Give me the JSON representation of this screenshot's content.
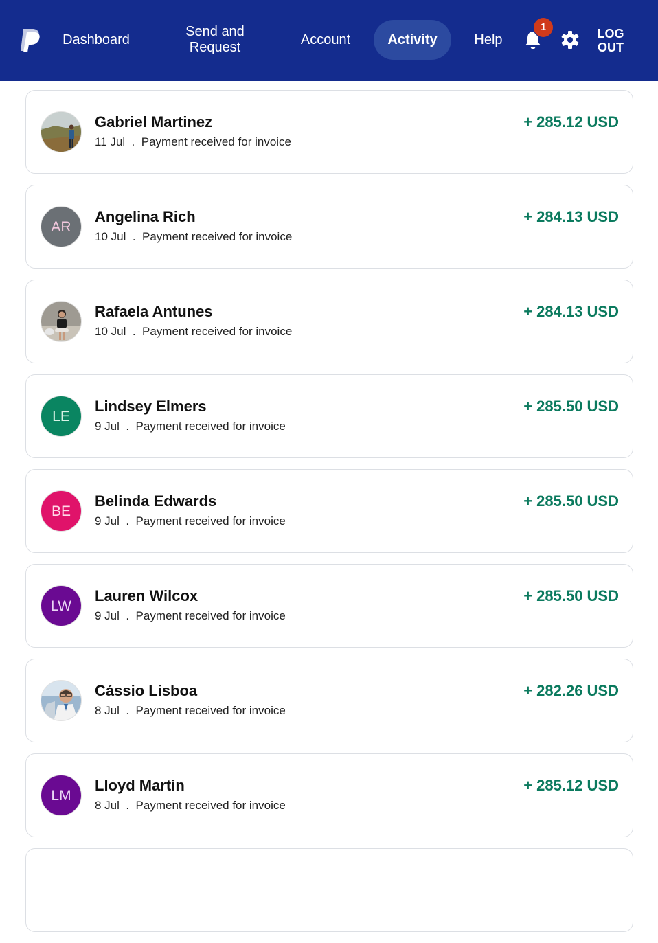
{
  "nav": {
    "dashboard": "Dashboard",
    "send_request": "Send and\nRequest",
    "account": "Account",
    "activity": "Activity",
    "help": "Help",
    "notification_count": "1",
    "logout": "LOG\nOUT"
  },
  "colors": {
    "header_bg": "#142c8e",
    "amount_green": "#0b7a5e",
    "badge_red": "#d03a1b"
  },
  "transactions": [
    {
      "name": "Gabriel Martinez",
      "date": "11 Jul",
      "description": "Payment received for invoice",
      "amount": "+ 285.12 USD",
      "avatar": {
        "type": "photo",
        "icon": "photo-landscape-person-icon"
      }
    },
    {
      "name": "Angelina Rich",
      "date": "10 Jul",
      "description": "Payment received for invoice",
      "amount": "+ 284.13 USD",
      "avatar": {
        "type": "initials",
        "initials": "AR",
        "bg": "#6b7075",
        "fg": "#f3c8de"
      }
    },
    {
      "name": "Rafaela Antunes",
      "date": "10 Jul",
      "description": "Payment received for invoice",
      "amount": "+ 284.13 USD",
      "avatar": {
        "type": "photo",
        "icon": "photo-person-sitting-icon"
      }
    },
    {
      "name": "Lindsey Elmers",
      "date": "9 Jul",
      "description": "Payment received for invoice",
      "amount": "+ 285.50 USD",
      "avatar": {
        "type": "initials",
        "initials": "LE",
        "bg": "#0a8561",
        "fg": "#d9f2e6"
      }
    },
    {
      "name": "Belinda Edwards",
      "date": "9 Jul",
      "description": "Payment received for invoice",
      "amount": "+ 285.50 USD",
      "avatar": {
        "type": "initials",
        "initials": "BE",
        "bg": "#e0136a",
        "fg": "#ffd9e8"
      }
    },
    {
      "name": "Lauren Wilcox",
      "date": "9 Jul",
      "description": "Payment received for invoice",
      "amount": "+ 285.50 USD",
      "avatar": {
        "type": "initials",
        "initials": "LW",
        "bg": "#6a0a92",
        "fg": "#ead6f5"
      }
    },
    {
      "name": "Cássio Lisboa",
      "date": "8 Jul",
      "description": "Payment received for invoice",
      "amount": "+ 282.26 USD",
      "avatar": {
        "type": "photo",
        "icon": "photo-man-glasses-icon"
      }
    },
    {
      "name": "Lloyd Martin",
      "date": "8 Jul",
      "description": "Payment received for invoice",
      "amount": "+ 285.12 USD",
      "avatar": {
        "type": "initials",
        "initials": "LM",
        "bg": "#6a0a92",
        "fg": "#ead6f5"
      }
    },
    {
      "name": "",
      "date": "",
      "description": "",
      "amount": "",
      "avatar": {
        "type": "none"
      }
    }
  ]
}
